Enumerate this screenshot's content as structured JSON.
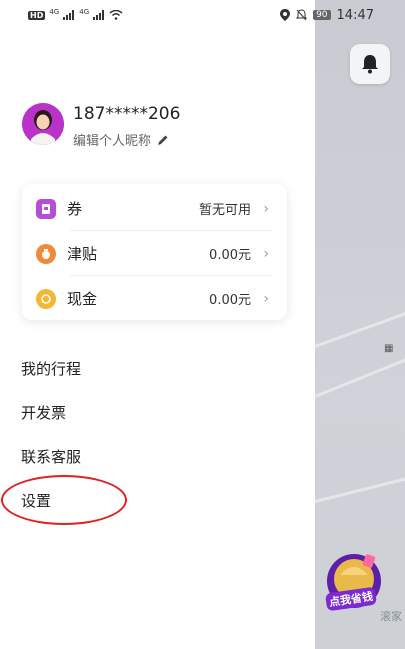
{
  "status_bar": {
    "network_badge": "HD",
    "signal_1": "4G",
    "signal_2": "4G",
    "battery": "90",
    "time": "14:47"
  },
  "profile": {
    "phone": "187*****206",
    "nickname_prompt": "编辑个人昵称"
  },
  "wallet": [
    {
      "label": "券",
      "value": "暂无可用",
      "icon": "coupon-icon",
      "color": "#b54dd6"
    },
    {
      "label": "津贴",
      "value": "0.00元",
      "icon": "allowance-icon",
      "color": "#f08a3a"
    },
    {
      "label": "现金",
      "value": "0.00元",
      "icon": "cash-icon",
      "color": "#f2b733"
    }
  ],
  "menu": [
    {
      "label": "我的行程"
    },
    {
      "label": "开发票"
    },
    {
      "label": "联系客服"
    },
    {
      "label": "设置"
    }
  ],
  "map": {
    "promo_label": "点我省钱",
    "partial_text": "滚家"
  }
}
